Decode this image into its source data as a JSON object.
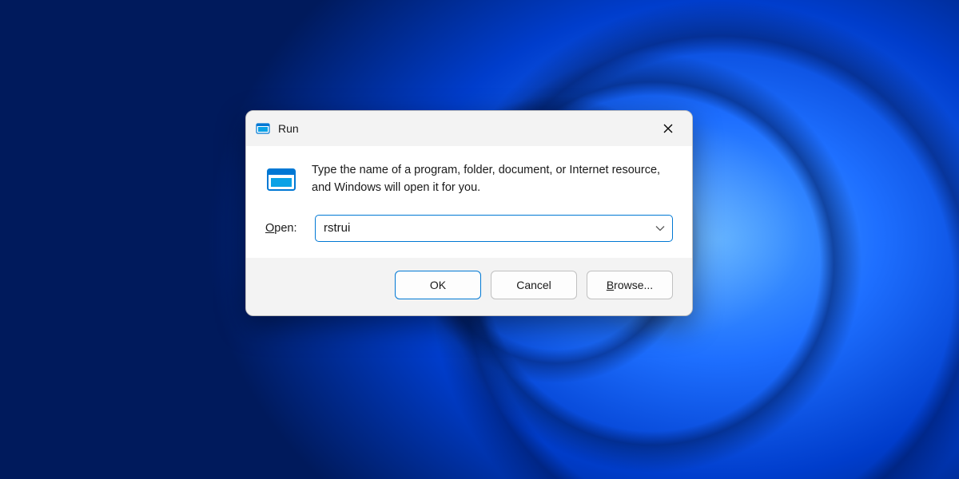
{
  "dialog": {
    "title": "Run",
    "description": "Type the name of a program, folder, document, or Internet resource, and Windows will open it for you.",
    "open_label_prefix": "O",
    "open_label_rest": "pen:",
    "input_value": "rstrui ",
    "buttons": {
      "ok": "OK",
      "cancel": "Cancel",
      "browse_prefix": "B",
      "browse_rest": "rowse..."
    }
  }
}
